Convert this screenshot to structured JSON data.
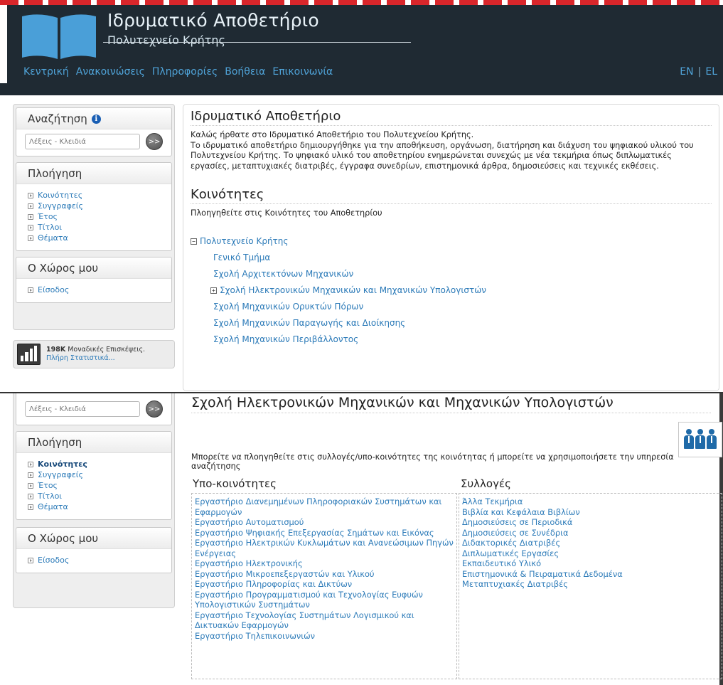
{
  "header": {
    "title": "Ιδρυματικό Αποθετήριο",
    "subtitle": "Πολυτεχνείο Κρήτης",
    "nav": [
      "Κεντρική",
      "Ανακοινώσεις",
      "Πληροφορίες",
      "Βοήθεια",
      "Επικοινωνία"
    ],
    "lang": {
      "en": "EN",
      "sep": "|",
      "el": "EL"
    }
  },
  "colors": {
    "header_bg": "#1f2a33",
    "link": "#2b7ab8",
    "logo": "#4a9fd8",
    "accent_red": "#d9262b"
  },
  "sidebar": {
    "search_title": "Αναζήτηση",
    "search_placeholder": "Λέξεις - Κλειδιά",
    "search_button": ">>",
    "browse_title": "Πλοήγηση",
    "browse_items": [
      "Κοινότητες",
      "Συγγραφείς",
      "Έτος",
      "Τίτλοι",
      "Θέματα"
    ],
    "my_space_title": "Ο Χώρος μου",
    "my_space_items": [
      "Είσοδος"
    ]
  },
  "stats": {
    "count": "198K",
    "label": "Μοναδικές Επισκέψεις.",
    "link": "Πλήρη Στατιστικά..."
  },
  "main": {
    "title": "Ιδρυματικό Αποθετήριο",
    "welcome_1": "Καλώς ήρθατε στο Ιδρυματικό Αποθετήριο του Πολυτεχνείου Κρήτης.",
    "welcome_2": "Το ιδρυματικό αποθετήριο δημιουργήθηκε για την αποθήκευση, οργάνωση, διατήρηση και διάχυση του ψηφιακού υλικού του Πολυτεχνείου Κρήτης. Το ψηφιακό υλικό του αποθετηρίου ενημερώνεται συνεχώς με νέα τεκμήρια όπως διπλωματικές εργασίες, μεταπτυχιακές διατριβές, έγγραφα συνεδρίων, επιστημονικά άρθρα, δημοσιεύσεις και τεχνικές εκθέσεις.",
    "communities_title": "Κοινότητες",
    "communities_sub": "Πλοηγηθείτε στις Κοινότητες του Αποθετηρίου",
    "tree_root": "Πολυτεχνείο Κρήτης",
    "tree_children": [
      "Γενικό Τμήμα",
      "Σχολή Αρχιτεκτόνων Μηχανικών",
      "Σχολή Ηλεκτρονικών Μηχανικών και Μηχανικών Υπολογιστών",
      "Σχολή Μηχανικών Ορυκτών Πόρων",
      "Σχολή Μηχανικών Παραγωγής και Διοίκησης",
      "Σχολή Μηχανικών Περιβάλλοντος"
    ]
  },
  "school": {
    "title": "Σχολή Ηλεκτρονικών Μηχανικών και Μηχανικών Υπολογιστών",
    "description": "Μπορείτε να πλοηγηθείτε στις συλλογές/υπο-κοινότητες της κοινότητας ή μπορείτε να χρησιμοποιήσετε την υπηρεσία αναζήτησης",
    "subcommunities_title": "Υπο-κοινότητες",
    "subcommunities": [
      "Εργαστήριο Διανεμημένων Πληροφοριακών Συστημάτων και Εφαρμογών",
      "Εργαστήριο Αυτοματισμού",
      "Εργαστήριο Ψηφιακής Επεξεργασίας Σημάτων και Εικόνας",
      "Εργαστήριο Ηλεκτρικών Κυκλωμάτων και Ανανεώσιμων Πηγών Ενέργειας",
      "Εργαστήριο Ηλεκτρονικής",
      "Εργαστήριο Μικροεπεξεργαστών και Υλικού",
      "Εργαστήριο Πληροφορίας και Δικτύων",
      "Εργαστήριο Προγραμματισμού και Τεχνολογίας Ευφυών Υπολογιστικών Συστημάτων",
      "Εργαστήριο Τεχνολογίας Συστημάτων Λογισμικού και Δικτυακών Εφαρμογών",
      "Εργαστήριο Τηλεπικοινωνιών"
    ],
    "collections_title": "Συλλογές",
    "collections": [
      "Άλλα Τεκμήρια",
      "Βιβλία και Κεφάλαια Βιβλίων",
      "Δημοσιεύσεις σε Περιοδικά",
      "Δημοσιεύσεις σε Συνέδρια",
      "Διδακτορικές Διατριβές",
      "Διπλωματικές Εργασίες",
      "Εκπαιδευτικό Υλικό",
      "Επιστημονικά & Πειραματικά Δεδομένα",
      "Μεταπτυχιακές Διατριβές"
    ]
  },
  "icons": {
    "logo": "open-book-icon",
    "info": "info-icon",
    "bullet": "arrow-bullet-icon",
    "stats": "bar-chart-icon",
    "community": "people-icon"
  }
}
